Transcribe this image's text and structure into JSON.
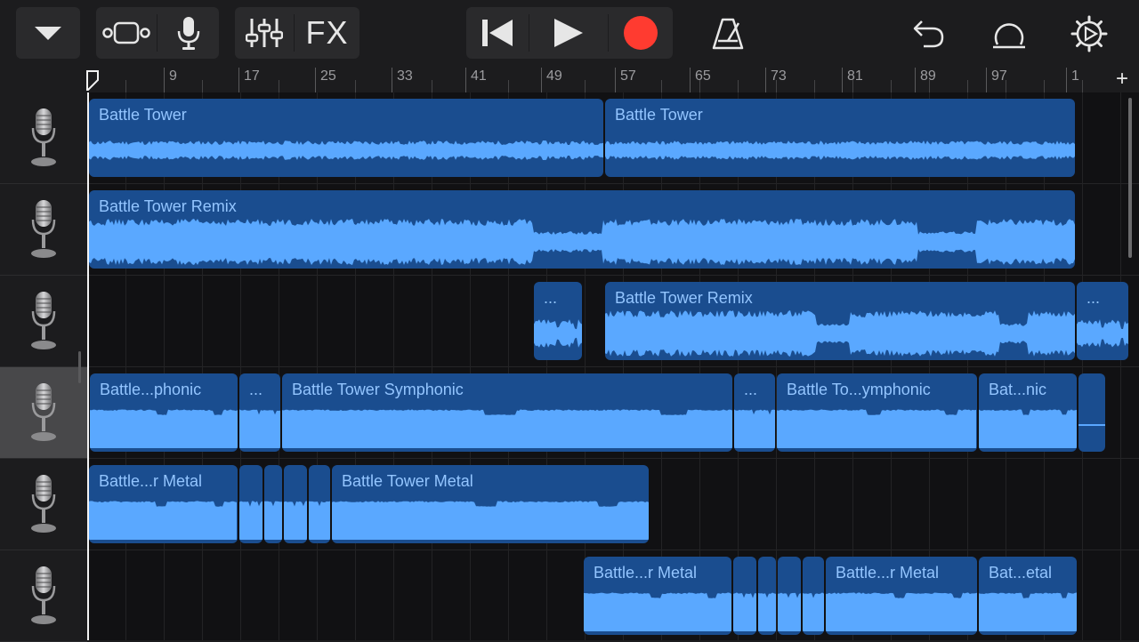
{
  "toolbar": {
    "fx_label": "FX",
    "record_color": "#ff3b30"
  },
  "ruler": {
    "bar_numbers": [
      "9",
      "17",
      "25",
      "33",
      "41",
      "49",
      "57",
      "65",
      "73",
      "81",
      "89",
      "97",
      "1"
    ],
    "add_track_label": "+"
  },
  "tracks": [
    {
      "instrument": "microphone-icon",
      "selected": false
    },
    {
      "instrument": "microphone-icon",
      "selected": false
    },
    {
      "instrument": "microphone-icon",
      "selected": false
    },
    {
      "instrument": "microphone-icon",
      "selected": true
    },
    {
      "instrument": "microphone-icon",
      "selected": false
    },
    {
      "instrument": "microphone-icon",
      "selected": false
    }
  ],
  "regions": [
    {
      "name": "Battle Tower"
    },
    {
      "name": "Battle Tower"
    },
    {
      "name": "Battle Tower Remix"
    },
    {
      "name": "..."
    },
    {
      "name": "Battle Tower Remix"
    },
    {
      "name": "..."
    },
    {
      "name": "Battle...phonic"
    },
    {
      "name": "..."
    },
    {
      "name": "Battle Tower Symphonic"
    },
    {
      "name": "..."
    },
    {
      "name": "Battle To...ymphonic"
    },
    {
      "name": "Bat...nic"
    },
    {
      "name": ""
    },
    {
      "name": "Battle...r Metal"
    },
    {
      "name": ""
    },
    {
      "name": ""
    },
    {
      "name": ""
    },
    {
      "name": ""
    },
    {
      "name": "Battle Tower Metal"
    },
    {
      "name": "Battle...r Metal"
    },
    {
      "name": ""
    },
    {
      "name": ""
    },
    {
      "name": ""
    },
    {
      "name": ""
    },
    {
      "name": "Battle...r Metal"
    },
    {
      "name": "Bat...etal"
    }
  ],
  "colors": {
    "region_fill": "#1a4d8f",
    "waveform": "#5aa8ff",
    "region_label": "#93c5ff"
  }
}
